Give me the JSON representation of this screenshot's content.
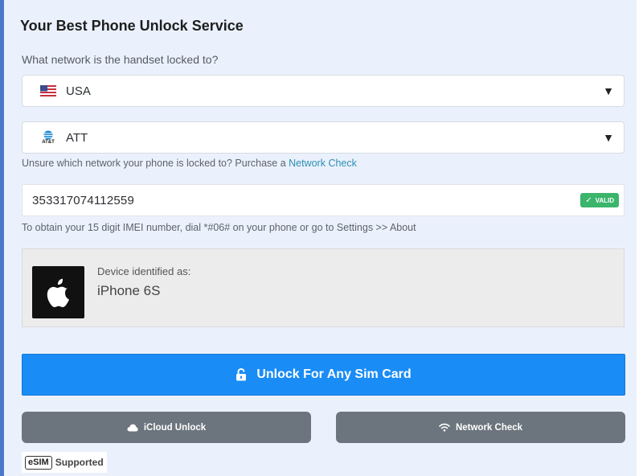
{
  "title": "Your Best Phone Unlock Service",
  "question": "What network is the handset locked to?",
  "country_select": {
    "icon": "usa-flag-icon",
    "value": "USA",
    "arrow": "▼"
  },
  "network_select": {
    "icon": "att-logo-icon",
    "logo_text": "AT&T",
    "value": "ATT",
    "arrow": "▼"
  },
  "network_hint": {
    "text": "Unsure which network your phone is locked to? Purchase a ",
    "link": "Network Check"
  },
  "imei": {
    "value": "353317074112559",
    "badge_check": "✓",
    "badge_text": "VALID"
  },
  "imei_hint": "To obtain your 15 digit IMEI number, dial *#06# on your phone or go to Settings >> About",
  "device": {
    "icon": "apple-logo-icon",
    "label": "Device identified as:",
    "name": "iPhone 6S"
  },
  "unlock_button": {
    "icon": "lock-icon",
    "label": "Unlock For Any Sim Card",
    "color": "#1a8cf6"
  },
  "icloud_button": {
    "icon": "cloud-icon",
    "label": "iCloud Unlock"
  },
  "network_check_button": {
    "icon": "wifi-icon",
    "label": "Network Check"
  },
  "esim_badge": {
    "box_text": "eSIM",
    "label": "Supported"
  },
  "colors": {
    "accent": "#4a78c9",
    "valid": "#3bb56b",
    "gray_button": "#6c757d",
    "link": "#2b8fb4"
  }
}
